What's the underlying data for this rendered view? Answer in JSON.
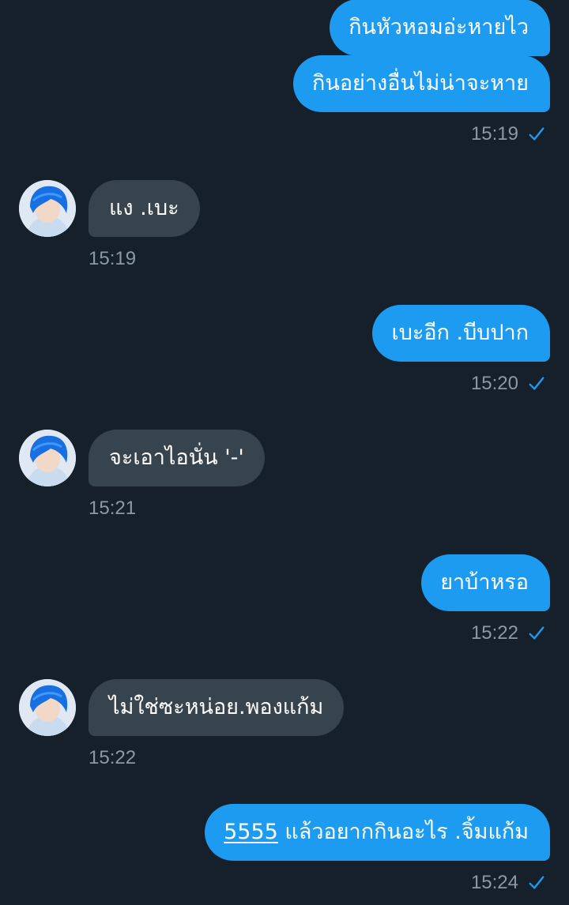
{
  "messages": [
    {
      "id": "m1",
      "direction": "out",
      "text": "กินหัวหอมอ่ะหายไว"
    },
    {
      "id": "m2",
      "direction": "out",
      "text": "กินอย่างอื่นไม่น่าจะหาย",
      "time": "15:19",
      "status_icon": "check-icon"
    },
    {
      "id": "m3",
      "direction": "in",
      "text": "แง .เบะ",
      "time": "15:19",
      "avatar_icon": "avatar-blue-hair"
    },
    {
      "id": "m4",
      "direction": "out",
      "text": "เบะอีก .บีบปาก",
      "time": "15:20",
      "status_icon": "check-icon"
    },
    {
      "id": "m5",
      "direction": "in",
      "text": "จะเอาไอนั่น '-'",
      "time": "15:21",
      "avatar_icon": "avatar-blue-hair"
    },
    {
      "id": "m6",
      "direction": "out",
      "text": "ยาบ้าหรอ",
      "time": "15:22",
      "status_icon": "check-icon"
    },
    {
      "id": "m7",
      "direction": "in",
      "text": "ไม่ใช่ซะหน่อย.พองแก้ม",
      "time": "15:22",
      "avatar_icon": "avatar-blue-hair"
    },
    {
      "id": "m8",
      "direction": "out",
      "link_text": "5555",
      "text": " แล้วอยากกินอะไร .จิ้มแก้ม",
      "time": "15:24",
      "status_icon": "check-icon"
    }
  ],
  "colors": {
    "background": "#15202b",
    "outgoing_bubble": "#1d9bf0",
    "incoming_bubble": "#38444d",
    "meta_text": "#8b98a5",
    "check": "#1d9bf0"
  }
}
